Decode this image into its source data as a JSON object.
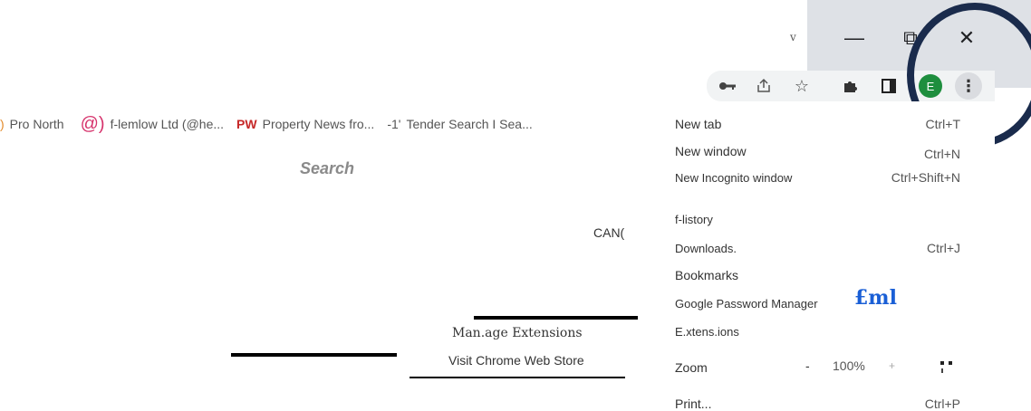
{
  "window": {
    "small_mark": "v",
    "minimize_glyph": "—",
    "restore_glyph": "⧉",
    "close_glyph": "✕"
  },
  "toolbar": {
    "icons": [
      "key-icon",
      "share-icon",
      "star-icon",
      "puzzle-icon",
      "sidepanel-icon"
    ],
    "avatar_letter": "E",
    "menu_glyph": "⋮"
  },
  "bookmarks": {
    "items": [
      {
        "prefix": ")",
        "label": "Pro North"
      },
      {
        "prefix": "@)",
        "label": "f-lemlow Ltd (@he..."
      },
      {
        "prefix": "PW",
        "label": "Property News fro..."
      },
      {
        "prefix": "-1'",
        "label": "Tender Search I Sea..."
      }
    ]
  },
  "page": {
    "search_label": "Search",
    "can_text": "CAN("
  },
  "extensions_popup": {
    "manage_label": "Man.age Extensions",
    "visit_store_label": "Visit Chrome Web Store"
  },
  "menu": {
    "new_tab": {
      "label": "New tab",
      "shortcut": "Ctrl+T"
    },
    "new_window": {
      "label": "New window",
      "shortcut": "Ctrl+N"
    },
    "new_incognito": {
      "label": "New Incognito window",
      "shortcut": "Ctrl+Shift+N"
    },
    "history": {
      "label": "f-listory"
    },
    "downloads": {
      "label": "Downloads.",
      "shortcut": "Ctrl+J"
    },
    "bookmarks": {
      "label": "Bookmarks"
    },
    "password_manager": {
      "label": "Google Password Manager",
      "logo_text": "£ml"
    },
    "extensions": {
      "label": "E.xtens.ions"
    },
    "zoom": {
      "label": "Zoom",
      "minus": "-",
      "value": "100%",
      "plus": "+",
      "fullscreen_glyph": "▪▪"
    },
    "print": {
      "label": "Print...",
      "shortcut": "Ctrl+P"
    }
  },
  "colors": {
    "annotation_circle": "#1a2b4c",
    "avatar_bg": "#1e8e3e",
    "titlebar_bg": "#dee1e6"
  }
}
